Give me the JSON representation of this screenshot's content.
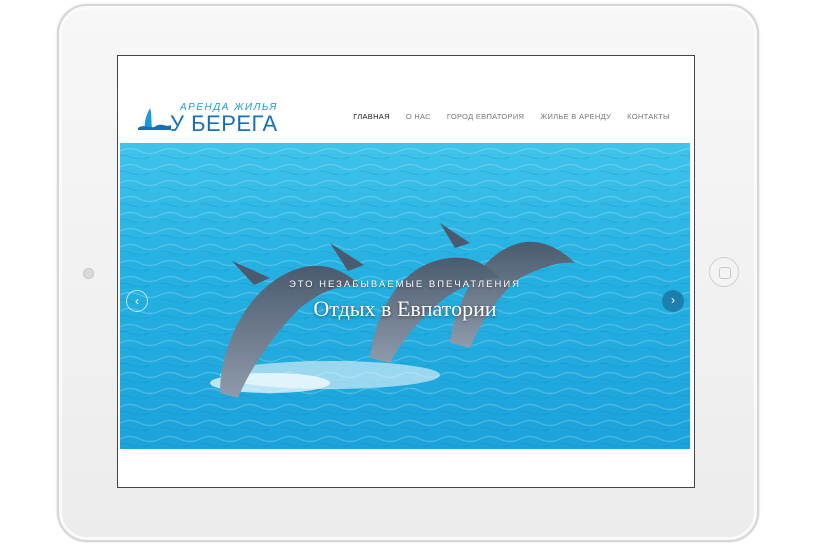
{
  "site": {
    "logo_top": "АРЕНДА ЖИЛЬЯ",
    "logo_bottom": "У БЕРЕГА"
  },
  "nav": {
    "items": [
      "ГЛАВНАЯ",
      "О НАС",
      "ГОРОД ЕВПАТОРИЯ",
      "ЖИЛЬЕ В АРЕНДУ",
      "КОНТАКТЫ"
    ],
    "active": "ГЛАВНАЯ"
  },
  "hero": {
    "subtitle": "ЭТО НЕЗАБЫВАЕМЫЕ ВПЕЧАТЛЕНИЯ",
    "title": "Отдых в Евпатории",
    "prev_icon": "chevron-left-icon",
    "next_icon": "chevron-right-icon"
  },
  "colors": {
    "brand": "#1570b8",
    "water": "#25b1e2",
    "arrow": "#1d7fae"
  }
}
